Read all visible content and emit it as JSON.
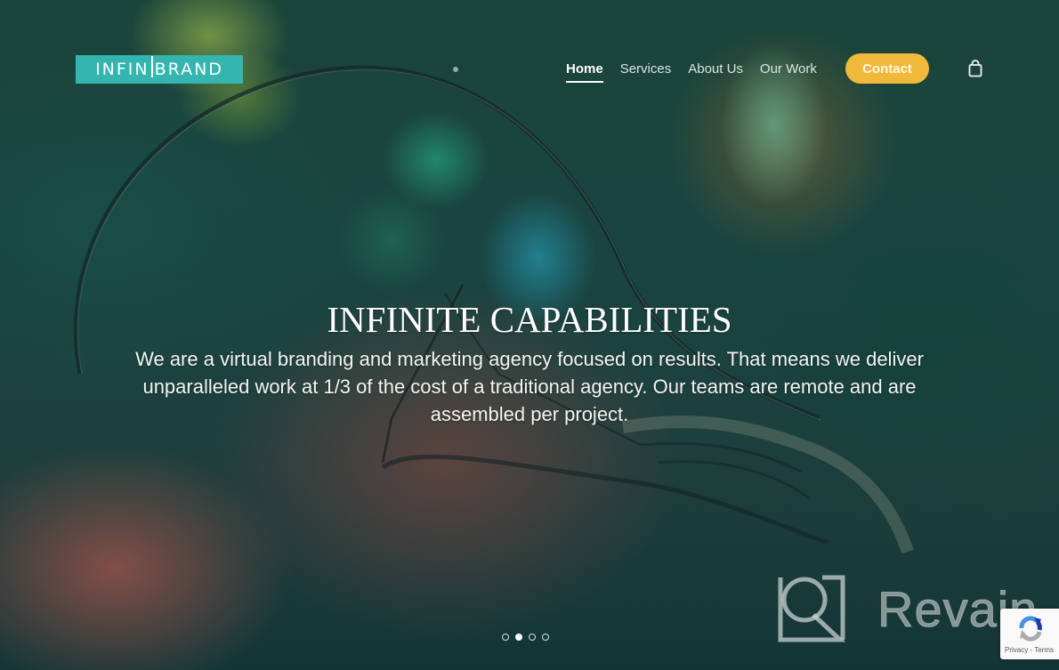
{
  "brand": {
    "logo_left": "INFIN",
    "logo_right": "BRAND",
    "logo_color": "#35b5b0"
  },
  "nav": {
    "items": [
      {
        "label": "Home",
        "active": true
      },
      {
        "label": "Services",
        "active": false
      },
      {
        "label": "About Us",
        "active": false
      },
      {
        "label": "Our Work",
        "active": false
      }
    ],
    "contact_label": "Contact",
    "contact_color": "#f0b93a",
    "cart_icon": "shopping-bag-icon"
  },
  "hero": {
    "title": "INFINITE CAPABILITIES",
    "description": "We are a virtual branding and marketing agency focused on results. That means we deliver\nunparalleled work at 1/3 of the cost of a traditional agency. Our teams are remote and  are\nassembled per project.",
    "slides": {
      "total": 4,
      "active_index": 1
    }
  },
  "watermark": {
    "text": "Revain"
  },
  "recaptcha": {
    "privacy_label": "Privacy",
    "separator": " - ",
    "terms_label": "Terms"
  }
}
